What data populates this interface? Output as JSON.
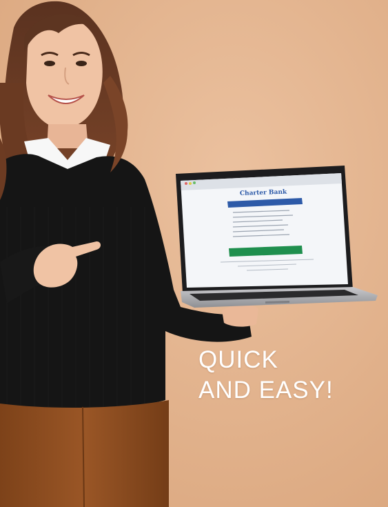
{
  "headline": {
    "line1": "QUICK",
    "line2": "AND EASY!"
  },
  "laptop_screen": {
    "logo_text": "Charter Bank"
  },
  "colors": {
    "background": "#e4b48f",
    "sweater": "#161616",
    "pants": "#8a4b1f",
    "headline_text": "#ffffff",
    "bank_blue": "#2d5aa8",
    "bank_green": "#1f8f4e"
  }
}
